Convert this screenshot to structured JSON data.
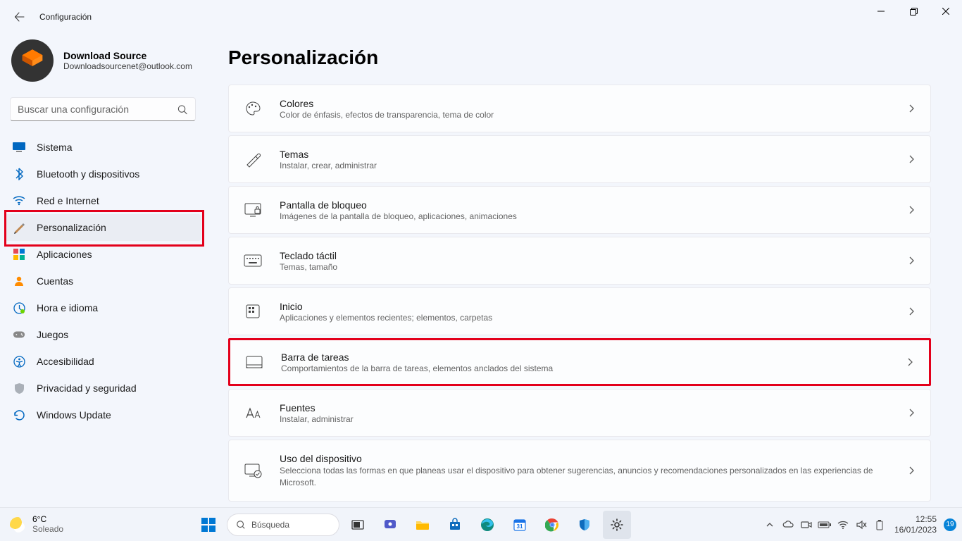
{
  "titlebar": {
    "app_title": "Configuración"
  },
  "profile": {
    "name": "Download Source",
    "email": "Downloadsourcenet@outlook.com"
  },
  "search": {
    "placeholder": "Buscar una configuración"
  },
  "nav": [
    {
      "id": "sistema",
      "label": "Sistema"
    },
    {
      "id": "bluetooth",
      "label": "Bluetooth y dispositivos"
    },
    {
      "id": "red",
      "label": "Red e Internet"
    },
    {
      "id": "personalizacion",
      "label": "Personalización",
      "active": true
    },
    {
      "id": "aplicaciones",
      "label": "Aplicaciones"
    },
    {
      "id": "cuentas",
      "label": "Cuentas"
    },
    {
      "id": "hora",
      "label": "Hora e idioma"
    },
    {
      "id": "juegos",
      "label": "Juegos"
    },
    {
      "id": "accesibilidad",
      "label": "Accesibilidad"
    },
    {
      "id": "privacidad",
      "label": "Privacidad y seguridad"
    },
    {
      "id": "update",
      "label": "Windows Update"
    }
  ],
  "page": {
    "title": "Personalización"
  },
  "cards": [
    {
      "id": "colores",
      "title": "Colores",
      "sub": "Color de énfasis, efectos de transparencia, tema de color"
    },
    {
      "id": "temas",
      "title": "Temas",
      "sub": "Instalar, crear, administrar"
    },
    {
      "id": "bloqueo",
      "title": "Pantalla de bloqueo",
      "sub": "Imágenes de la pantalla de bloqueo, aplicaciones, animaciones"
    },
    {
      "id": "teclado",
      "title": "Teclado táctil",
      "sub": "Temas, tamaño"
    },
    {
      "id": "inicio",
      "title": "Inicio",
      "sub": "Aplicaciones y elementos recientes; elementos, carpetas"
    },
    {
      "id": "barra",
      "title": "Barra de tareas",
      "sub": "Comportamientos de la barra de tareas, elementos anclados del sistema",
      "highlight": true
    },
    {
      "id": "fuentes",
      "title": "Fuentes",
      "sub": "Instalar, administrar"
    },
    {
      "id": "uso",
      "title": "Uso del dispositivo",
      "sub": "Selecciona todas las formas en que planeas usar el dispositivo para obtener sugerencias, anuncios y recomendaciones personalizados en las experiencias de Microsoft.",
      "usage": true
    }
  ],
  "taskbar": {
    "weather": {
      "temp": "6°C",
      "cond": "Soleado"
    },
    "search_label": "Búsqueda",
    "clock": {
      "time": "12:55",
      "date": "16/01/2023"
    },
    "notif_count": "19"
  }
}
